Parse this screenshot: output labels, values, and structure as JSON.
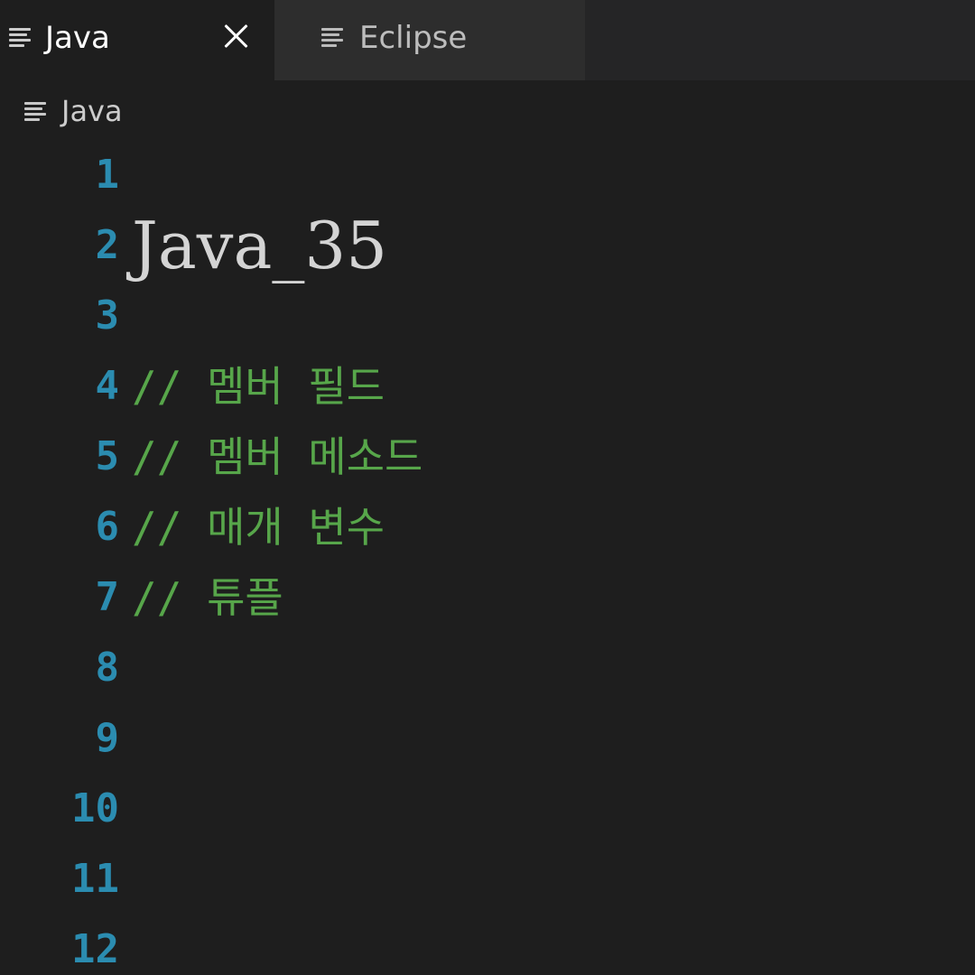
{
  "tabs": [
    {
      "label": "Java",
      "active": true,
      "icon": "lines-icon"
    },
    {
      "label": "Eclipse",
      "active": false,
      "icon": "lines-icon"
    }
  ],
  "breadcrumb": {
    "label": "Java",
    "icon": "lines-icon"
  },
  "editor": {
    "lines": [
      {
        "number": "1",
        "text": ""
      },
      {
        "number": "2",
        "text": "Java_35",
        "kind": "heading"
      },
      {
        "number": "3",
        "text": ""
      },
      {
        "number": "4",
        "text": "// 멤버 필드",
        "kind": "comment"
      },
      {
        "number": "5",
        "text": "// 멤버 메소드",
        "kind": "comment"
      },
      {
        "number": "6",
        "text": "// 매개 변수",
        "kind": "comment"
      },
      {
        "number": "7",
        "text": "// 튜플",
        "kind": "comment"
      },
      {
        "number": "8",
        "text": ""
      },
      {
        "number": "9",
        "text": ""
      },
      {
        "number": "10",
        "text": ""
      },
      {
        "number": "11",
        "text": ""
      },
      {
        "number": "12",
        "text": ""
      }
    ]
  },
  "colors": {
    "background": "#1e1e1e",
    "tabbar": "#252526",
    "inactive_tab": "#2d2d2d",
    "line_number": "#2b8cb0",
    "comment": "#57a64a",
    "text": "#d4d4d4"
  }
}
